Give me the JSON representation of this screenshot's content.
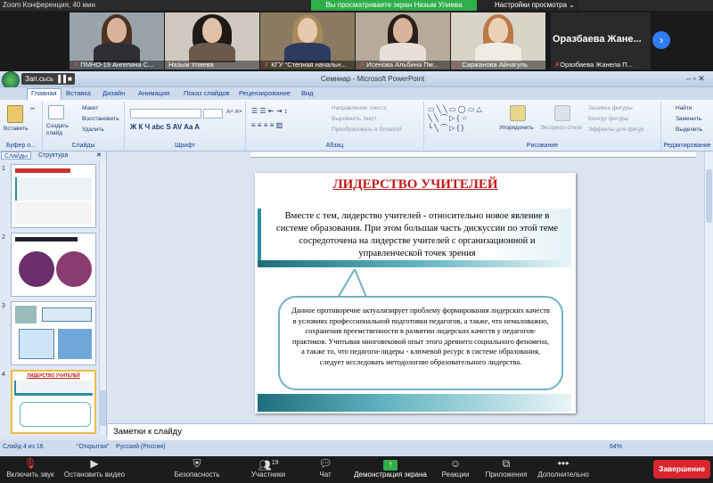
{
  "zoom": {
    "window_title": "Zoom Конференция, 40 мин",
    "share_banner": "Вы просматриваете экран Назым Улиева",
    "view_options": "Настройки просмотра",
    "participants": [
      {
        "name": "ПМНО-19 Ангелина С..."
      },
      {
        "name": "Назым Улиева"
      },
      {
        "name": "КГУ \"Степная начальн..."
      },
      {
        "name": "Исенова Альбина Пм..."
      },
      {
        "name": "Саржанова Айнагуль"
      },
      {
        "name": "Оразбаева Жанела П..."
      }
    ],
    "name_tile_big": "Оразбаева  Жане...",
    "toolbar": {
      "mute": "Включить звук",
      "stop_video": "Остановить видео",
      "security": "Безопасность",
      "participants": "Участники",
      "participants_count": "19",
      "chat": "Чат",
      "share": "Демонстрация экрана",
      "reactions": "Реакции",
      "apps": "Приложения",
      "more": "Дополнительно",
      "end": "Завершение"
    }
  },
  "ppt": {
    "title": "Семинар - Microsoft PowerPoint",
    "recording": "Зап.сьсь",
    "tabs": [
      "Главная",
      "Вставка",
      "Дизайн",
      "Анимация",
      "Показ слайдов",
      "Рецензирование",
      "Вид"
    ],
    "ribbon": {
      "clipboard": {
        "paste": "Вставить",
        "label": "Буфер о..."
      },
      "slides": {
        "create": "Создать слайд",
        "layout": "Макет",
        "restore": "Восстановить",
        "delete": "Удалить",
        "label": "Слайды"
      },
      "font_label": "Шрифт",
      "paragraph": {
        "direction": "Направление текста",
        "align": "Выровнять текст",
        "smartart": "Преобразовать в SmartArt",
        "label": "Абзац"
      },
      "drawing": {
        "arrange": "Упорядочить",
        "quick_styles": "Экспресс-стили",
        "fill": "Заливка фигуры",
        "outline": "Контур фигуры",
        "effects": "Эффекты для фигур",
        "label": "Рисование"
      },
      "editing": {
        "find": "Найти",
        "replace": "Заменить",
        "select": "Выделить",
        "label": "Редактирование"
      }
    },
    "pane_tabs": [
      "Слайды",
      "Структура"
    ],
    "thumb_numbers": [
      "1",
      "2",
      "3",
      "4"
    ],
    "thumb4_title": "ЛИДЕРСТВО УЧИТЕЛЕЙ",
    "slide": {
      "title": "ЛИДЕРСТВО УЧИТЕЛЕЙ",
      "box_text": "Вместе с тем, лидерство учителей - относительно новое явление в системе образования. При этом большая часть дискуссии по этой теме сосредоточена на лидерстве учителей с организационной и управленческой точек зрения",
      "callout_text": "Данное противоречие актуализирует проблему формирования лидерских качеств в условиях профессиональной подготовки педагогов, а также, что немаловажно, сохранения преемственности в развитии лидерских качеств у педагогов-практиков. Учитывая многовековой опыт этого древнего социального феномена, а также то, что педагоги-лидеры - ключевой ресурс в системе образования, следует исследовать методологию образовательного лидерства."
    },
    "notes_placeholder": "Заметки к слайду",
    "status": {
      "slide": "Слайд 4 из 16",
      "theme": "\"Открытая\"",
      "lang": "Русский (Россия)",
      "zoom": "64%"
    }
  }
}
